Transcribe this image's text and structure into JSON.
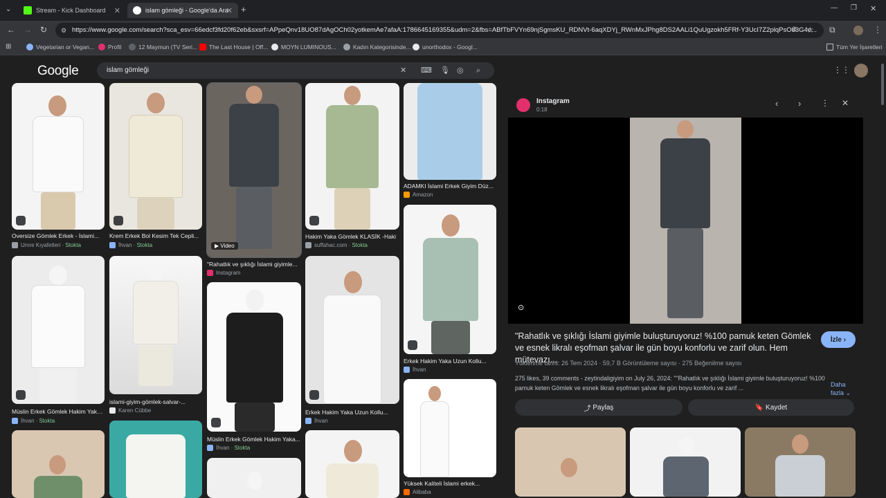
{
  "tabs": [
    {
      "label": "Stream - Kick Dashboard",
      "favicon_color": "#53fc18",
      "active": false
    },
    {
      "label": "islam gömleği - Google'da Ara",
      "favicon_color": "#ffffff",
      "active": true
    }
  ],
  "address_bar": {
    "url": "https://www.google.com/search?sca_esv=66edcf3fd20f62eb&sxsrf=APpeQnv18UO87dAgOCh02yotkemAe7afaA:1786645169355&udm=2&fbs=ABfTbFVYn69njSgmsKU_RDNVt-6aqXDYj_RWnMxJPhg8DS2AALi1QuUgzokh5FRf-Y3UcI7Z2plqPsOd3G4e..."
  },
  "bookmarks": [
    {
      "label": "Vegetarian or Vegan...",
      "color": "#8ab4f8"
    },
    {
      "label": "Profil",
      "color": "#e1306c"
    },
    {
      "label": "12 Maymun (TV Seri...",
      "color": "#5f6368"
    },
    {
      "label": "The Last House | Off...",
      "color": "#ff0000"
    },
    {
      "label": "MOYN LUMINOUS...",
      "color": "#e8eaed"
    },
    {
      "label": "Kadın Kategorisinde...",
      "color": "#9aa0a6"
    },
    {
      "label": "unorthodox - Googl...",
      "color": "#e8eaed"
    }
  ],
  "bookmarks_right": "Tüm Yer İşaretleri",
  "google": {
    "logo": "Google",
    "query": "islam gömleği"
  },
  "results": [
    {
      "caption": "Oversize Gömlek Erkek - İslami...",
      "source": "Umre Kıyafetleri",
      "stock": "Stokta"
    },
    {
      "caption": "Krem Erkek Bol Kesim Tek Cepli...",
      "source": "İhvan",
      "stock": "Stokta"
    },
    {
      "caption": "\"Rahatlık ve şıklığı İslami giyimle...",
      "source": "Instagram",
      "stock": "",
      "video_label": "Video"
    },
    {
      "caption": "Hakim Yaka Gömlek KLASİK -Haki",
      "source": "suffahac.com",
      "stock": "Stokta"
    },
    {
      "caption": "ADAMKI İslami Erkek Giyim Düz...",
      "source": "Amazon",
      "stock": ""
    },
    {
      "caption": "Müslin Erkek Gömlek Hakim Yaka...",
      "source": "İhvan",
      "stock": "Stokta"
    },
    {
      "caption": "islami-giyim-gömlek-salvar-...",
      "source": "Karen Cübbe",
      "stock": ""
    },
    {
      "caption": "Müslin Erkek Gömlek Hakim Yaka...",
      "source": "İhvan",
      "stock": "Stokta"
    },
    {
      "caption": "Erkek Hakim Yaka Uzun Kollu...",
      "source": "İhvan",
      "stock": ""
    },
    {
      "caption": "Erkek Hakim Yaka Uzun Kollu...",
      "source": "İhvan",
      "stock": ""
    },
    {
      "caption": "Yüksek Kaliteli İslami erkek...",
      "source": "Alibaba",
      "stock": ""
    }
  ],
  "panel": {
    "source": "Instagram",
    "duration": "0:18",
    "title": "\"Rahatlık ve şıklığı İslami giyimle buluşturuyoruz! %100 pamuk keten Gömlek ve esnek likralı eşofman şalvar ile gün boyu konforlu ve zarif olun. Hem mütevazı...",
    "watch_button": "İzle",
    "upload_date": "Yüklenme tarihi: 26 Tem 2024",
    "views": "59,7 B Görüntüleme sayısı",
    "likes": "275 Beğenilme sayısı",
    "description": "275 likes, 39 comments - zeytindaligiyim on July 26, 2024: \"\"Rahatlık ve şıklığı İslami giyimle buluşturuyoruz! %100 pamuk keten Gömlek ve esnek likralı eşofman şalvar ile gün boyu konforlu ve zarif ...",
    "more": "Daha fazla",
    "share": "Paylaş",
    "save": "Kaydet"
  },
  "colors": {
    "accent_blue": "#8ab4f8",
    "stock_green": "#81c995",
    "panel_bg": "#1f1f1f"
  }
}
